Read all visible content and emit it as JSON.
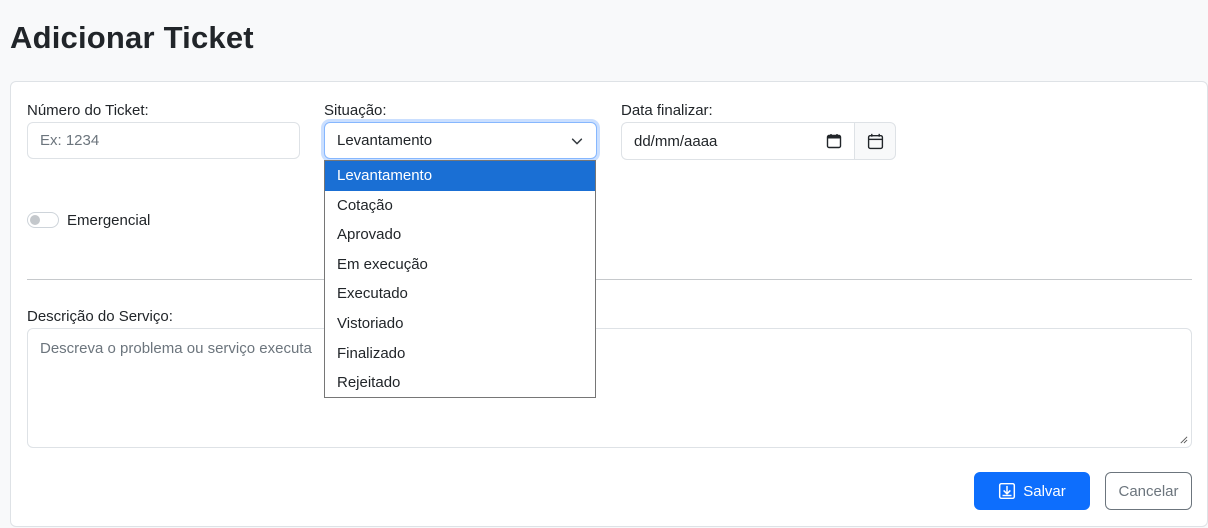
{
  "page": {
    "title": "Adicionar Ticket"
  },
  "form": {
    "ticket_number": {
      "label": "Número do Ticket:",
      "placeholder": "Ex: 1234",
      "value": ""
    },
    "status": {
      "label": "Situação:",
      "selected": "Levantamento",
      "options": [
        "Levantamento",
        "Cotação",
        "Aprovado",
        "Em execução",
        "Executado",
        "Vistoriado",
        "Finalizado",
        "Rejeitado"
      ]
    },
    "finish_date": {
      "label": "Data finalizar:",
      "placeholder": "dd/mm/aaaa"
    },
    "emergency": {
      "label": "Emergencial",
      "checked": false
    },
    "description": {
      "label": "Descrição do Serviço:",
      "placeholder": "Descreva o problema ou serviço executa"
    }
  },
  "actions": {
    "save_label": "Salvar",
    "cancel_label": "Cancelar"
  },
  "colors": {
    "primary": "#0d6efd",
    "dropdown_highlight": "#1a6fd4",
    "secondary": "#6c757d"
  },
  "icons": {
    "chevron": "chevron-down-icon",
    "calendar": "calendar-icon",
    "save": "save-icon"
  }
}
